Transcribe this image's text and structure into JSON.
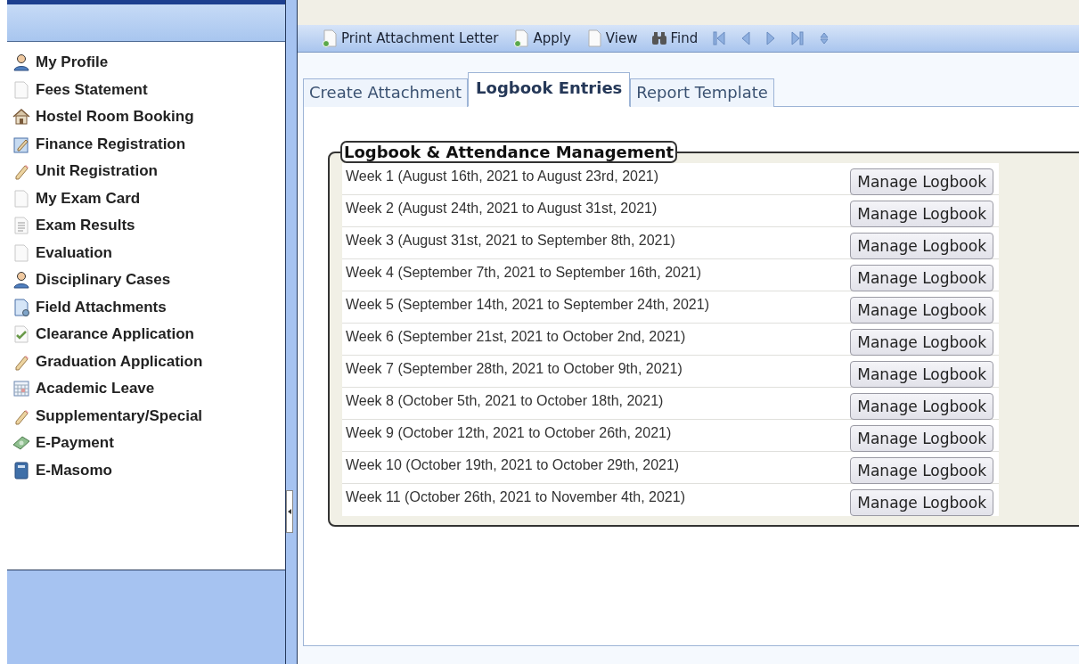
{
  "sidebar": {
    "items": [
      {
        "label": "My Profile",
        "kind": "person"
      },
      {
        "label": "Fees Statement",
        "kind": "page"
      },
      {
        "label": "Hostel Room Booking",
        "kind": "house"
      },
      {
        "label": "Finance Registration",
        "kind": "edit"
      },
      {
        "label": "Unit Registration",
        "kind": "pencil"
      },
      {
        "label": "My Exam Card",
        "kind": "page"
      },
      {
        "label": "Exam Results",
        "kind": "lines"
      },
      {
        "label": "Evaluation",
        "kind": "page"
      },
      {
        "label": "Disciplinary Cases",
        "kind": "person"
      },
      {
        "label": "Field Attachments",
        "kind": "attach"
      },
      {
        "label": "Clearance Application",
        "kind": "check"
      },
      {
        "label": "Graduation Application",
        "kind": "pencil"
      },
      {
        "label": "Academic Leave",
        "kind": "calendar"
      },
      {
        "label": "Supplementary/Special",
        "kind": "pencil"
      },
      {
        "label": "E-Payment",
        "kind": "money"
      },
      {
        "label": "E-Masomo",
        "kind": "book"
      }
    ]
  },
  "toolbar": {
    "buttons": [
      {
        "label": "Print Attachment Letter",
        "kind": "newpage"
      },
      {
        "label": "Apply",
        "kind": "newpage"
      },
      {
        "label": "View",
        "kind": "page"
      },
      {
        "label": "Find",
        "kind": "binoculars"
      }
    ],
    "nav": [
      {
        "kind": "first"
      },
      {
        "kind": "prev"
      },
      {
        "kind": "next"
      },
      {
        "kind": "last"
      },
      {
        "kind": "refresh"
      }
    ]
  },
  "tabs": [
    {
      "label": "Create Attachment",
      "selected": false
    },
    {
      "label": "Logbook Entries",
      "selected": true
    },
    {
      "label": "Report Template",
      "selected": false
    }
  ],
  "fieldset": {
    "legend": "Logbook & Attendance Management",
    "rows": [
      {
        "week": "Week 1 (August 16th, 2021 to August 23rd, 2021)",
        "button": "Manage Logbook"
      },
      {
        "week": "Week 2 (August 24th, 2021 to August 31st, 2021)",
        "button": "Manage Logbook"
      },
      {
        "week": "Week 3 (August 31st, 2021 to September 8th, 2021)",
        "button": "Manage Logbook"
      },
      {
        "week": "Week 4 (September 7th, 2021 to September 16th, 2021)",
        "button": "Manage Logbook"
      },
      {
        "week": "Week 5 (September 14th, 2021 to September 24th, 2021)",
        "button": "Manage Logbook"
      },
      {
        "week": "Week 6 (September 21st, 2021 to October 2nd, 2021)",
        "button": "Manage Logbook"
      },
      {
        "week": "Week 7 (September 28th, 2021 to October 9th, 2021)",
        "button": "Manage Logbook"
      },
      {
        "week": "Week 8 (October 5th, 2021 to October 18th, 2021)",
        "button": "Manage Logbook"
      },
      {
        "week": "Week 9 (October 12th, 2021 to October 26th, 2021)",
        "button": "Manage Logbook"
      },
      {
        "week": "Week 10 (October 19th, 2021 to October 29th, 2021)",
        "button": "Manage Logbook"
      },
      {
        "week": "Week 11 (October 26th, 2021 to November 4th, 2021)",
        "button": "Manage Logbook"
      }
    ]
  }
}
